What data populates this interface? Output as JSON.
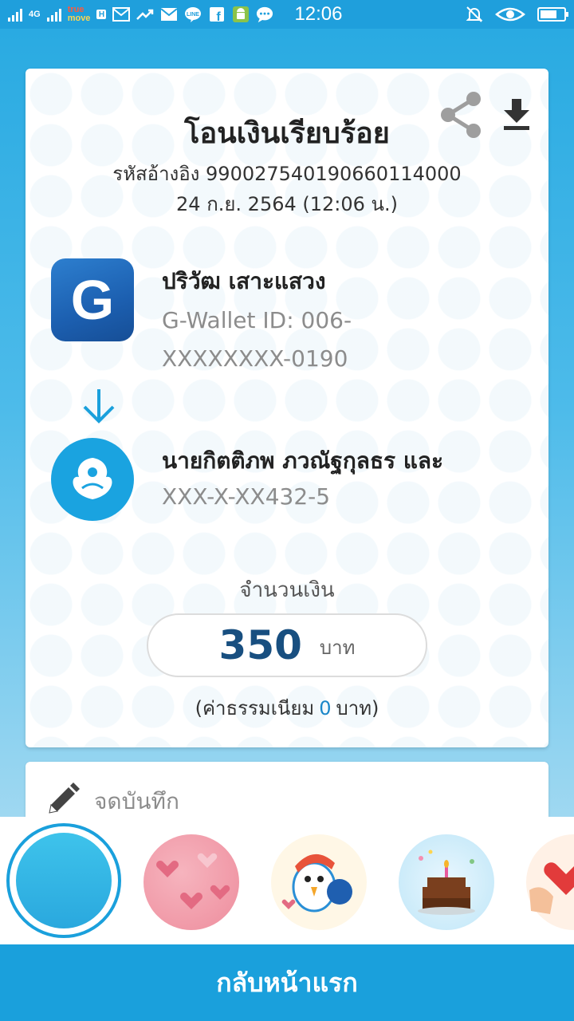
{
  "status_bar": {
    "network": "4G",
    "carrier_top": "true",
    "carrier_bottom": "move",
    "carrier_badge": "H",
    "time": "12:06",
    "battery_percent": 75,
    "icons": [
      "signal-icon",
      "gmail-icon",
      "trend-icon",
      "mail-icon",
      "line-icon",
      "facebook-icon",
      "android-icon",
      "chat-icon",
      "mute-icon",
      "eye-icon",
      "battery-icon"
    ]
  },
  "receipt": {
    "title": "โอนเงินเรียบร้อย",
    "reference": "รหัสอ้างอิง 990027540190660114000",
    "datetime": "24 ก.ย. 2564 (12:06 น.)",
    "sender": {
      "name": "ปริวัฒ เสาะแสวง",
      "id_line1": "G-Wallet ID: 006-",
      "id_line2": "XXXXXXXX-0190",
      "logo_letter": "G"
    },
    "receiver": {
      "name": "นายกิตติภพ ภวณัฐกุลธร และ",
      "account": "XXX-X-XX432-5"
    },
    "amount_label": "จำนวนเงิน",
    "amount": "350",
    "currency": "บาท",
    "fee_prefix": "(ค่าธรรมเนียม",
    "fee_value": "0",
    "fee_suffix": "บาท)"
  },
  "memo": {
    "label": "จดบันทึก"
  },
  "themes": [
    "blue",
    "hearts",
    "bird",
    "cake",
    "hand"
  ],
  "home_button": "กลับหน้าแรก",
  "colors": {
    "primary": "#1aa0dc",
    "amount": "#184f80",
    "fee_value": "#1a86c8"
  }
}
